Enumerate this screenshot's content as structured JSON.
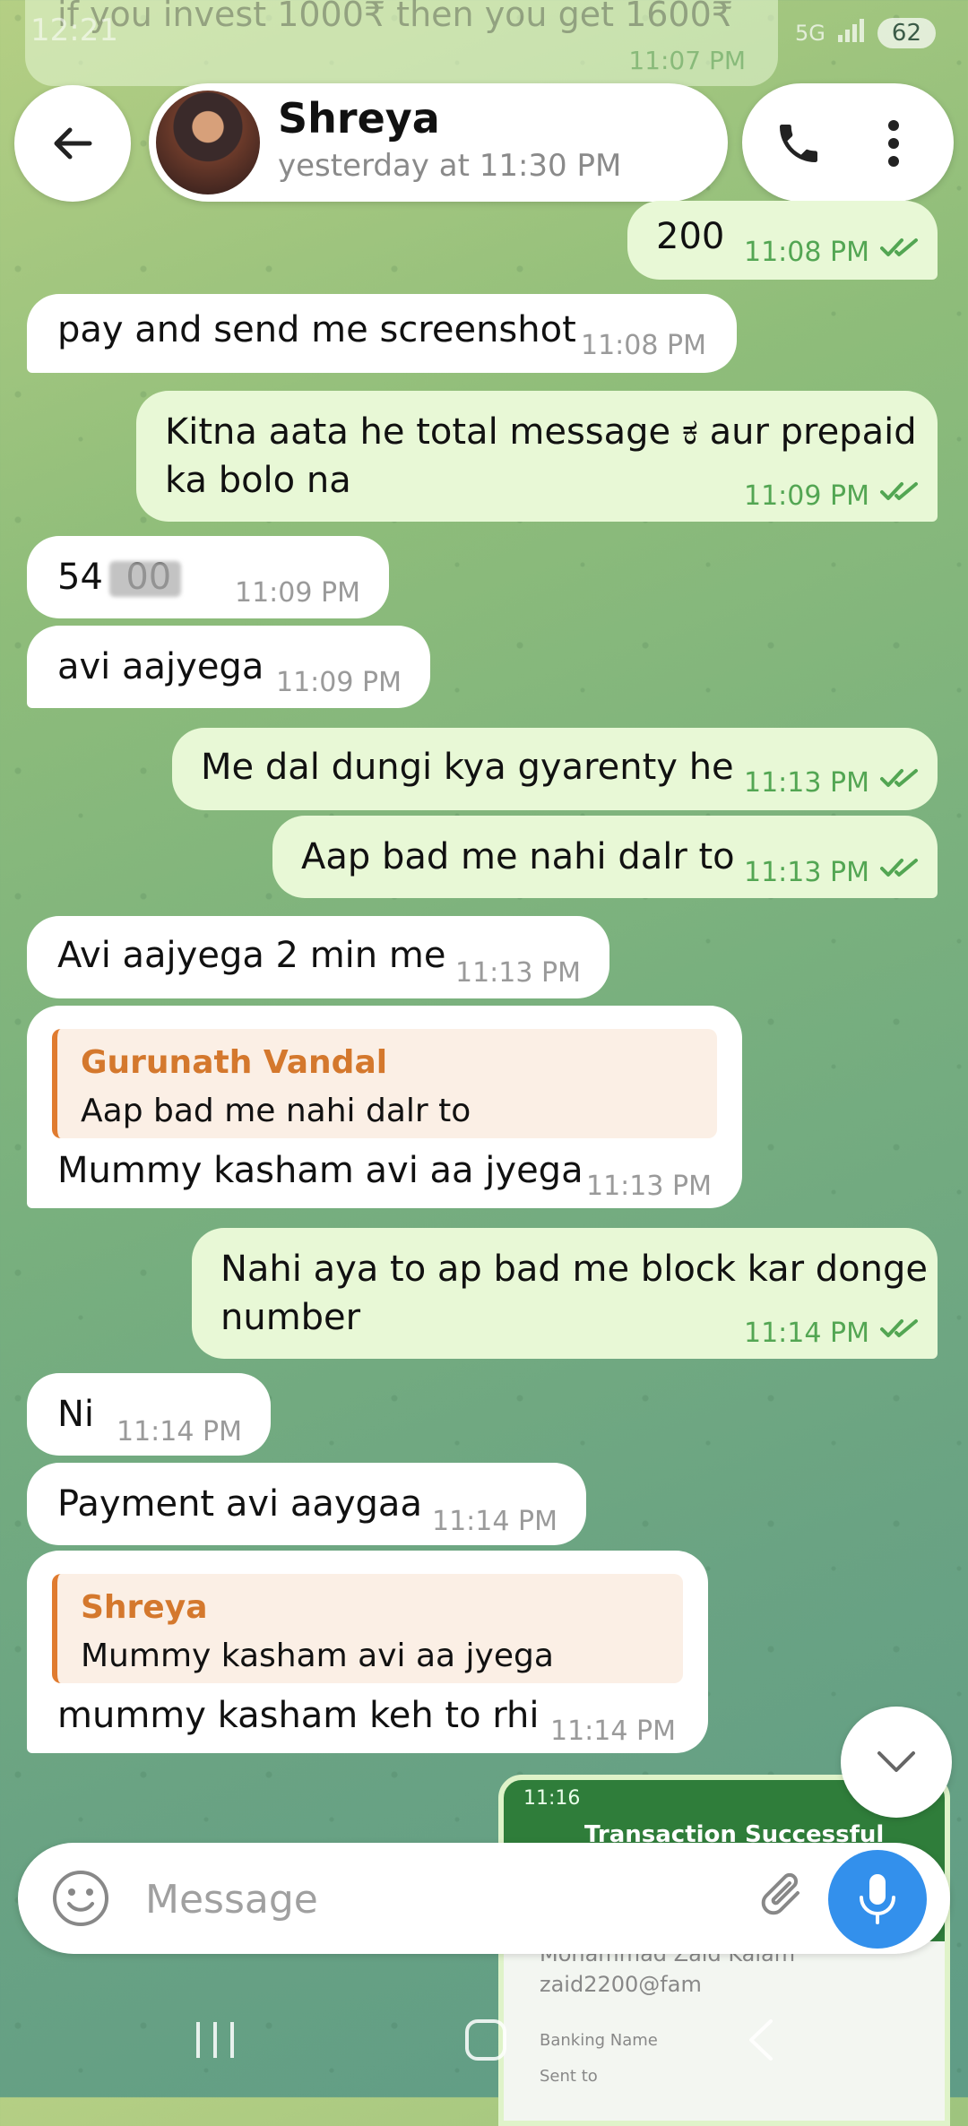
{
  "status_bar": {
    "time": "12:21",
    "network": "5G",
    "battery": "62"
  },
  "faded_message": {
    "text": "if you invest 1000₹ then you get 1600₹",
    "time": "11:07 PM"
  },
  "header": {
    "contact_name": "Shreya",
    "last_seen": "yesterday at 11:30 PM"
  },
  "messages": [
    {
      "dir": "out",
      "text": "200",
      "time": "11:08 PM"
    },
    {
      "dir": "in",
      "text": "pay and send me screenshot",
      "time": "11:08 PM"
    },
    {
      "dir": "out",
      "text": "Kitna aata he total message ಕ aur prepaid",
      "text2": "ka bolo na",
      "time": "11:09 PM"
    },
    {
      "dir": "in",
      "text": "54  00",
      "time": "11:09 PM"
    },
    {
      "dir": "in",
      "text": "avi aajyega",
      "time": "11:09 PM"
    },
    {
      "dir": "out",
      "text": "Me dal dungi kya gyarenty he",
      "time": "11:13 PM"
    },
    {
      "dir": "out",
      "text": "Aap bad me nahi dalr to",
      "time": "11:13 PM"
    },
    {
      "dir": "in",
      "text": "Avi aajyega 2 min me",
      "time": "11:13 PM"
    },
    {
      "dir": "in",
      "reply_name": "Gurunath Vandal",
      "reply_text": "Aap bad me nahi dalr to",
      "text": "Mummy kasham avi aa jyega",
      "time": "11:13 PM"
    },
    {
      "dir": "out",
      "text": "Nahi aya to ap bad me block kar donge",
      "text2": "number",
      "time": "11:14 PM"
    },
    {
      "dir": "in",
      "text": "Ni",
      "time": "11:14 PM"
    },
    {
      "dir": "in",
      "text": "Payment avi aaygaa",
      "time": "11:14 PM"
    },
    {
      "dir": "in",
      "reply_name": "Shreya",
      "reply_text": "Mummy kasham avi aa jyega",
      "text": "mummy kasham keh to rhi",
      "time": "11:14 PM"
    }
  ],
  "image_preview": {
    "time": "11:16",
    "title": "Transaction Successful",
    "payee": "Mohammad Zaid Kalam",
    "upi": "zaid2200@fam",
    "banking_name_label": "Banking Name",
    "sent_to_label": "Sent to"
  },
  "composer": {
    "placeholder": "Message"
  },
  "colors": {
    "accent": "#3390ec",
    "out_bubble": "#e8f8d6",
    "check": "#53a653",
    "reply_name": "#d4782d"
  }
}
